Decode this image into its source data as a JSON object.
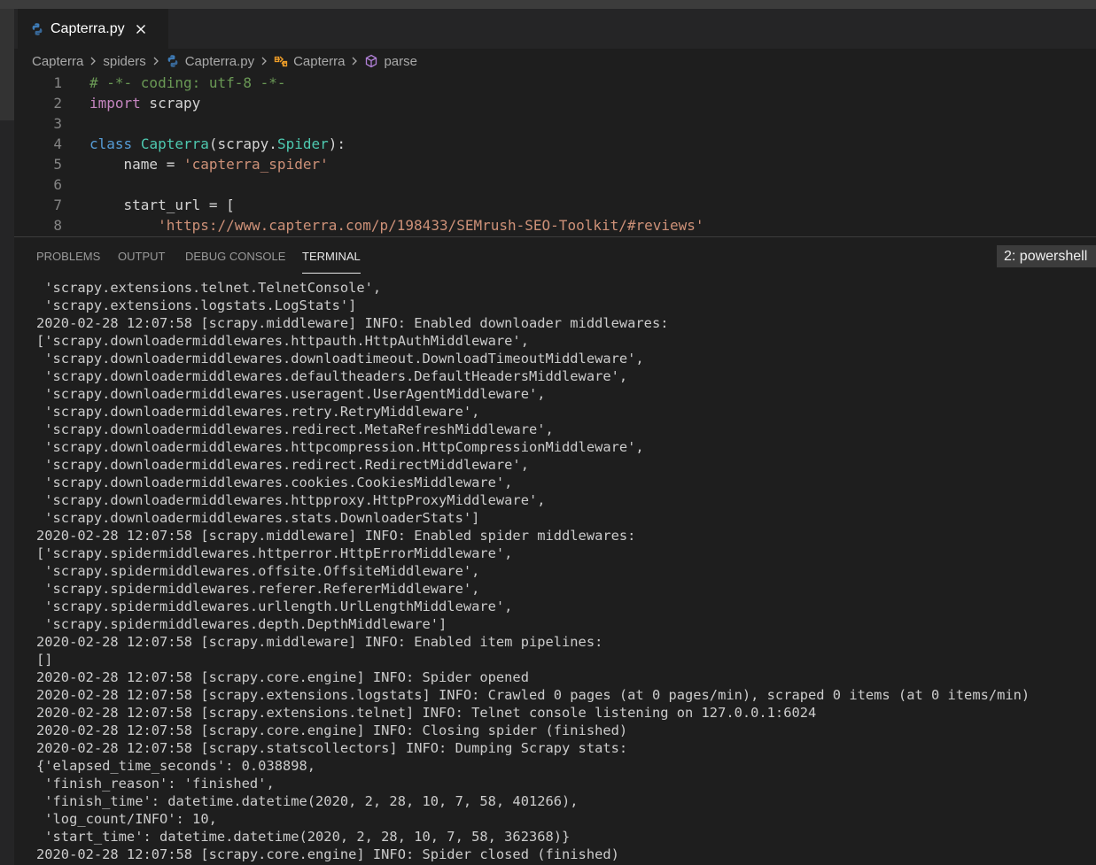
{
  "window": {
    "tab": {
      "label": "Capterra.py",
      "icon": "python-file-icon",
      "close_icon": "close-icon"
    }
  },
  "breadcrumb": {
    "items": [
      {
        "label": "Capterra"
      },
      {
        "label": "spiders"
      },
      {
        "label": "Capterra.py",
        "icon": "python-file-icon"
      },
      {
        "label": "Capterra",
        "icon": "class-icon"
      },
      {
        "label": "parse",
        "icon": "method-cube-icon"
      }
    ]
  },
  "editor": {
    "lines": [
      {
        "n": "1",
        "tokens": [
          {
            "t": "# -*- coding: utf-8 -*-",
            "c": "tk-comment"
          }
        ]
      },
      {
        "n": "2",
        "tokens": [
          {
            "t": "import",
            "c": "tk-kw"
          },
          {
            "t": " scrapy",
            "c": "tk-plain"
          }
        ]
      },
      {
        "n": "3",
        "tokens": []
      },
      {
        "n": "4",
        "tokens": [
          {
            "t": "class",
            "c": "tk-def"
          },
          {
            "t": " ",
            "c": "tk-plain"
          },
          {
            "t": "Capterra",
            "c": "tk-cls"
          },
          {
            "t": "(scrapy.",
            "c": "tk-plain"
          },
          {
            "t": "Spider",
            "c": "tk-cls"
          },
          {
            "t": "):",
            "c": "tk-plain"
          }
        ]
      },
      {
        "n": "5",
        "tokens": [
          {
            "t": "    name = ",
            "c": "tk-plain"
          },
          {
            "t": "'capterra_spider'",
            "c": "tk-str"
          }
        ]
      },
      {
        "n": "6",
        "tokens": []
      },
      {
        "n": "7",
        "tokens": [
          {
            "t": "    start_url = [",
            "c": "tk-plain"
          }
        ]
      },
      {
        "n": "8",
        "tokens": [
          {
            "t": "        ",
            "c": "tk-plain"
          },
          {
            "t": "'https://www.capterra.com/p/198433/SEMrush-SEO-Toolkit/#reviews'",
            "c": "tk-str"
          }
        ]
      }
    ]
  },
  "panel": {
    "tabs": [
      {
        "label": "PROBLEMS",
        "active": false
      },
      {
        "label": "OUTPUT",
        "active": false
      },
      {
        "label": "DEBUG CONSOLE",
        "active": false
      },
      {
        "label": "TERMINAL",
        "active": true
      }
    ],
    "shell": "2: powershell"
  },
  "terminal": {
    "lines": [
      " 'scrapy.extensions.telnet.TelnetConsole',",
      " 'scrapy.extensions.logstats.LogStats']",
      "2020-02-28 12:07:58 [scrapy.middleware] INFO: Enabled downloader middlewares:",
      "['scrapy.downloadermiddlewares.httpauth.HttpAuthMiddleware',",
      " 'scrapy.downloadermiddlewares.downloadtimeout.DownloadTimeoutMiddleware',",
      " 'scrapy.downloadermiddlewares.defaultheaders.DefaultHeadersMiddleware',",
      " 'scrapy.downloadermiddlewares.useragent.UserAgentMiddleware',",
      " 'scrapy.downloadermiddlewares.retry.RetryMiddleware',",
      " 'scrapy.downloadermiddlewares.redirect.MetaRefreshMiddleware',",
      " 'scrapy.downloadermiddlewares.httpcompression.HttpCompressionMiddleware',",
      " 'scrapy.downloadermiddlewares.redirect.RedirectMiddleware',",
      " 'scrapy.downloadermiddlewares.cookies.CookiesMiddleware',",
      " 'scrapy.downloadermiddlewares.httpproxy.HttpProxyMiddleware',",
      " 'scrapy.downloadermiddlewares.stats.DownloaderStats']",
      "2020-02-28 12:07:58 [scrapy.middleware] INFO: Enabled spider middlewares:",
      "['scrapy.spidermiddlewares.httperror.HttpErrorMiddleware',",
      " 'scrapy.spidermiddlewares.offsite.OffsiteMiddleware',",
      " 'scrapy.spidermiddlewares.referer.RefererMiddleware',",
      " 'scrapy.spidermiddlewares.urllength.UrlLengthMiddleware',",
      " 'scrapy.spidermiddlewares.depth.DepthMiddleware']",
      "2020-02-28 12:07:58 [scrapy.middleware] INFO: Enabled item pipelines:",
      "[]",
      "2020-02-28 12:07:58 [scrapy.core.engine] INFO: Spider opened",
      "2020-02-28 12:07:58 [scrapy.extensions.logstats] INFO: Crawled 0 pages (at 0 pages/min), scraped 0 items (at 0 items/min)",
      "2020-02-28 12:07:58 [scrapy.extensions.telnet] INFO: Telnet console listening on 127.0.0.1:6024",
      "2020-02-28 12:07:58 [scrapy.core.engine] INFO: Closing spider (finished)",
      "2020-02-28 12:07:58 [scrapy.statscollectors] INFO: Dumping Scrapy stats:",
      "{'elapsed_time_seconds': 0.038898,",
      " 'finish_reason': 'finished',",
      " 'finish_time': datetime.datetime(2020, 2, 28, 10, 7, 58, 401266),",
      " 'log_count/INFO': 10,",
      " 'start_time': datetime.datetime(2020, 2, 28, 10, 7, 58, 362368)}",
      "2020-02-28 12:07:58 [scrapy.core.engine] INFO: Spider closed (finished)"
    ]
  },
  "colors": {
    "editor_bg": "#1e1e1e",
    "tabstrip_bg": "#252526",
    "comment": "#6a9955",
    "keyword": "#c586c0",
    "storage": "#569cd6",
    "class_name": "#4ec9b0",
    "string": "#ce9178",
    "python_icon": "#3e7bb6",
    "class_icon": "#ee9d28",
    "method_icon": "#b180d7"
  }
}
